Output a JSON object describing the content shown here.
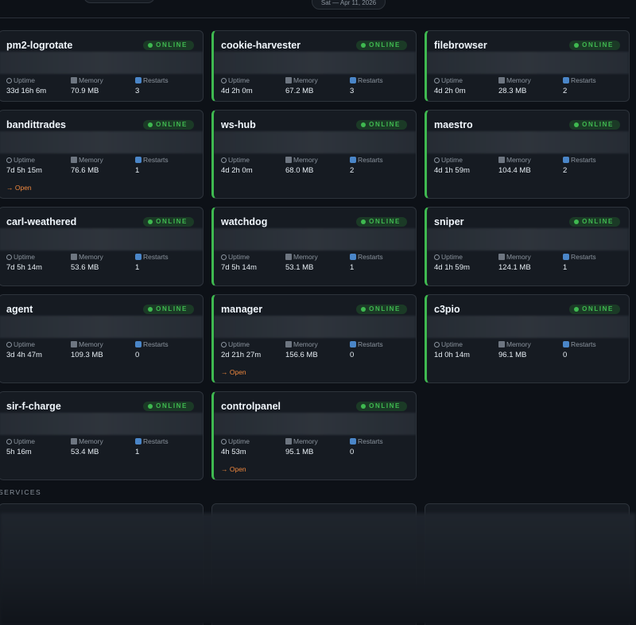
{
  "header": {
    "date": "Sat — Apr 11, 2026"
  },
  "status_label": "ONLINE",
  "stat_labels": {
    "uptime": "Uptime",
    "memory": "Memory",
    "restarts": "Restarts"
  },
  "open_label": "→ Open",
  "processes": [
    {
      "name": "pm2-logrotate",
      "uptime": "33d 16h 6m",
      "memory": "70.9 MB",
      "restarts": "3",
      "open": false
    },
    {
      "name": "cookie-harvester",
      "uptime": "4d 2h 0m",
      "memory": "67.2 MB",
      "restarts": "3",
      "open": false
    },
    {
      "name": "filebrowser",
      "uptime": "4d 2h 0m",
      "memory": "28.3 MB",
      "restarts": "2",
      "open": false
    },
    {
      "name": "bandittrades",
      "uptime": "7d 5h 15m",
      "memory": "76.6 MB",
      "restarts": "1",
      "open": true
    },
    {
      "name": "ws-hub",
      "uptime": "4d 2h 0m",
      "memory": "68.0 MB",
      "restarts": "2",
      "open": false
    },
    {
      "name": "maestro",
      "uptime": "4d 1h 59m",
      "memory": "104.4 MB",
      "restarts": "2",
      "open": false
    },
    {
      "name": "carl-weathered",
      "uptime": "7d 5h 14m",
      "memory": "53.6 MB",
      "restarts": "1",
      "open": false
    },
    {
      "name": "watchdog",
      "uptime": "7d 5h 14m",
      "memory": "53.1 MB",
      "restarts": "1",
      "open": false
    },
    {
      "name": "sniper",
      "uptime": "4d 1h 59m",
      "memory": "124.1 MB",
      "restarts": "1",
      "open": false
    },
    {
      "name": "agent",
      "uptime": "3d 4h 47m",
      "memory": "109.3 MB",
      "restarts": "0",
      "open": false
    },
    {
      "name": "manager",
      "uptime": "2d 21h 27m",
      "memory": "156.6 MB",
      "restarts": "0",
      "open": true
    },
    {
      "name": "c3pio",
      "uptime": "1d 0h 14m",
      "memory": "96.1 MB",
      "restarts": "0",
      "open": false
    },
    {
      "name": "sir-f-charge",
      "uptime": "5h 16m",
      "memory": "53.4 MB",
      "restarts": "1",
      "open": false
    },
    {
      "name": "controlpanel",
      "uptime": "4h 53m",
      "memory": "95.1 MB",
      "restarts": "0",
      "open": true
    }
  ],
  "services_label": "SERVICES",
  "colors": {
    "background": "#0d1117",
    "card": "#161b22",
    "online": "#3fb950",
    "open_link": "#f0883e"
  }
}
